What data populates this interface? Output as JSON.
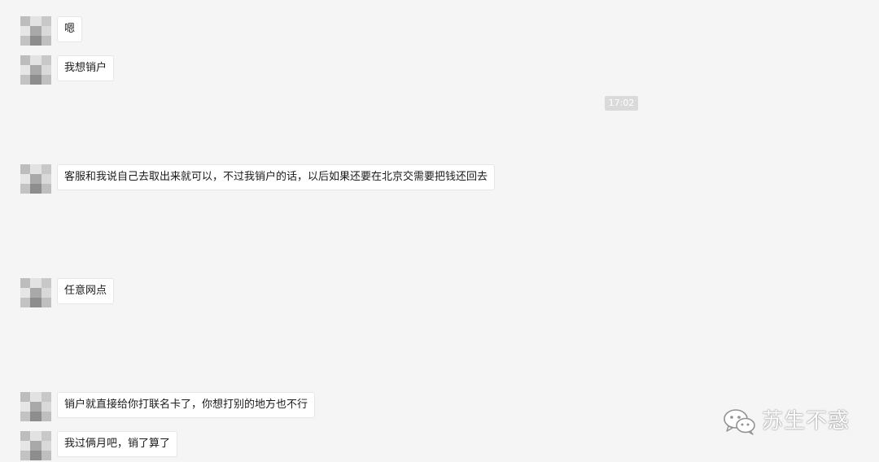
{
  "messages": [
    {
      "text": "嗯"
    },
    {
      "text": "我想销户"
    },
    {
      "text": "客服和我说自己去取出来就可以，不过我销户的话，以后如果还要在北京交需要把钱还回去"
    },
    {
      "text": "任意网点"
    },
    {
      "text": "销户就直接给你打联名卡了，你想打别的地方也不行"
    },
    {
      "text": "我过俩月吧，销了算了"
    }
  ],
  "timestamp": "17:02",
  "watermark": {
    "icon": "wechat-icon",
    "text": "苏生不惑"
  }
}
